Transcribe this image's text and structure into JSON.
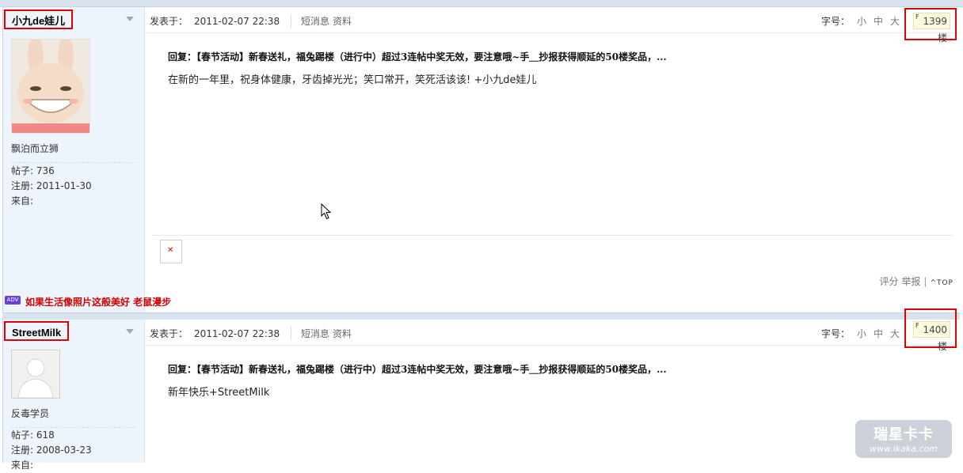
{
  "post1": {
    "username": "小九de娃儿",
    "rank": "飘泊而立狮",
    "stats": [
      "帖子: 736",
      "注册: 2011-01-30",
      "来自:"
    ],
    "time_label": "发表于：",
    "time": "2011-02-07 22:38",
    "links": [
      "短消息",
      "资料"
    ],
    "fontsize_label": "字号：",
    "fontsize_opts": [
      "小",
      "中",
      "大"
    ],
    "floor_marker": "F",
    "floor": "1399楼",
    "reply_title": "回复：【春节活动】新春送礼，福兔踢楼（进行中）超过3连帖中奖无效，要注意哦~手＿抄报获得顺延的50楼奖品，...",
    "message": "在新的一年里，祝身体健康，牙齿掉光光；笑口常开，笑死活该该! +小九de娃儿",
    "broken_image": "✕",
    "actions": {
      "rate": "评分",
      "report": "举报",
      "sep": "|",
      "top": "^TOP"
    },
    "ad_badge": "ADV",
    "ad_text": "如果生活像照片这般美好 老鼠漫步"
  },
  "post2": {
    "username": "StreetMilk",
    "rank": "反毒学员",
    "stats": [
      "帖子: 618",
      "注册: 2008-03-23",
      "来自:"
    ],
    "time_label": "发表于：",
    "time": "2011-02-07 22:38",
    "links": [
      "短消息",
      "资料"
    ],
    "fontsize_label": "字号：",
    "fontsize_opts": [
      "小",
      "中",
      "大"
    ],
    "floor_marker": "F",
    "floor": "1400楼",
    "reply_title": "回复：【春节活动】新春送礼，福兔踢楼（进行中）超过3连帖中奖无效，要注意哦~手＿抄报获得顺延的50楼奖品，...",
    "message": "新年快乐+StreetMilk"
  },
  "watermark": {
    "line1": "瑞星卡卡",
    "line2": "www.ikaka.com"
  },
  "colors": {
    "highlight_box": "#e00000",
    "side_bg": "#eef4fb",
    "ad_text": "#d00000"
  }
}
